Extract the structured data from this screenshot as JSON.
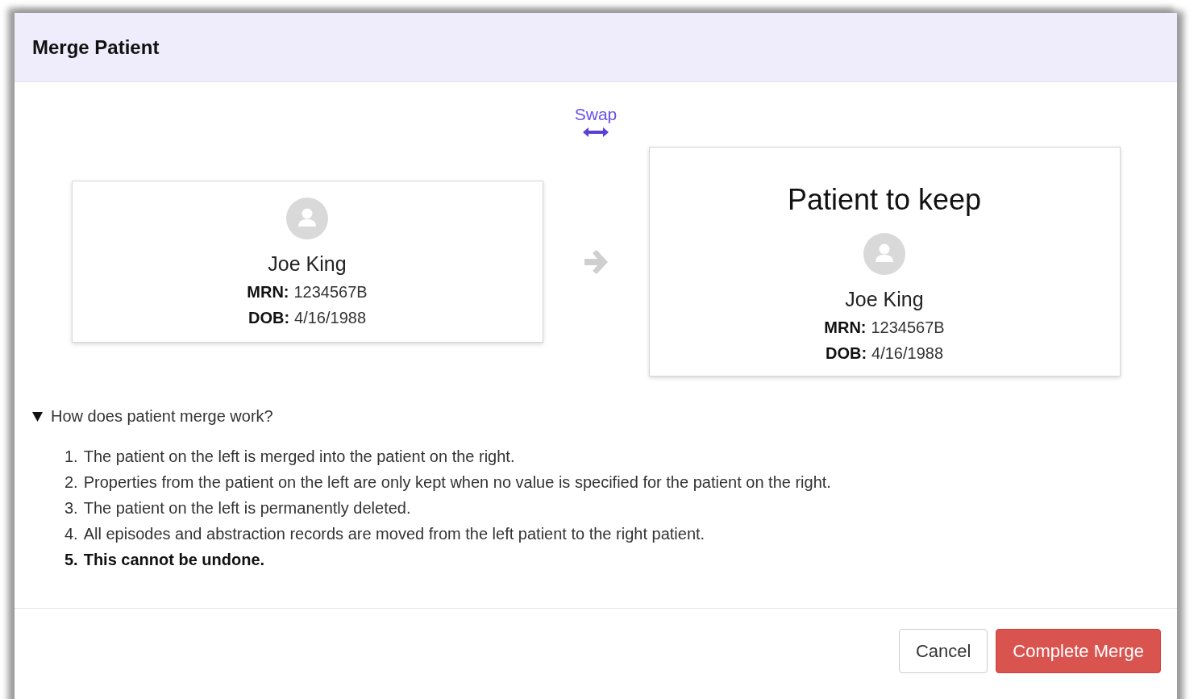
{
  "dialog": {
    "title": "Merge Patient"
  },
  "swap_link": {
    "label": "Swap"
  },
  "patients": [
    {
      "name": "Joe King",
      "fields": [
        {
          "label": "MRN:",
          "value": "1234567B"
        },
        {
          "label": "DOB:",
          "value": "4/16/1988"
        }
      ]
    },
    {
      "heading": "Patient to keep",
      "name": "Joe King",
      "fields": [
        {
          "label": "MRN:",
          "value": "1234567B"
        },
        {
          "label": "DOB:",
          "value": "4/16/1988"
        }
      ]
    }
  ],
  "help": {
    "summary": "How does patient merge work?",
    "expanded": true,
    "steps": [
      {
        "number": "1.",
        "text": "The patient on the left is merged into the patient on the right.",
        "strong": false
      },
      {
        "number": "2.",
        "text": "Properties from the patient on the left are only kept when no value is specified for the patient on the right.",
        "strong": false
      },
      {
        "number": "3.",
        "text": "The patient on the left is permanently deleted.",
        "strong": false
      },
      {
        "number": "4.",
        "text": "All episodes and abstraction records are moved from the left patient to the right patient.",
        "strong": false
      },
      {
        "number": "5.",
        "text": "This cannot be undone.",
        "strong": true
      }
    ]
  },
  "buttons": [
    {
      "label": "Cancel",
      "kind": "secondary"
    },
    {
      "label": "Complete Merge",
      "kind": "danger"
    }
  ]
}
